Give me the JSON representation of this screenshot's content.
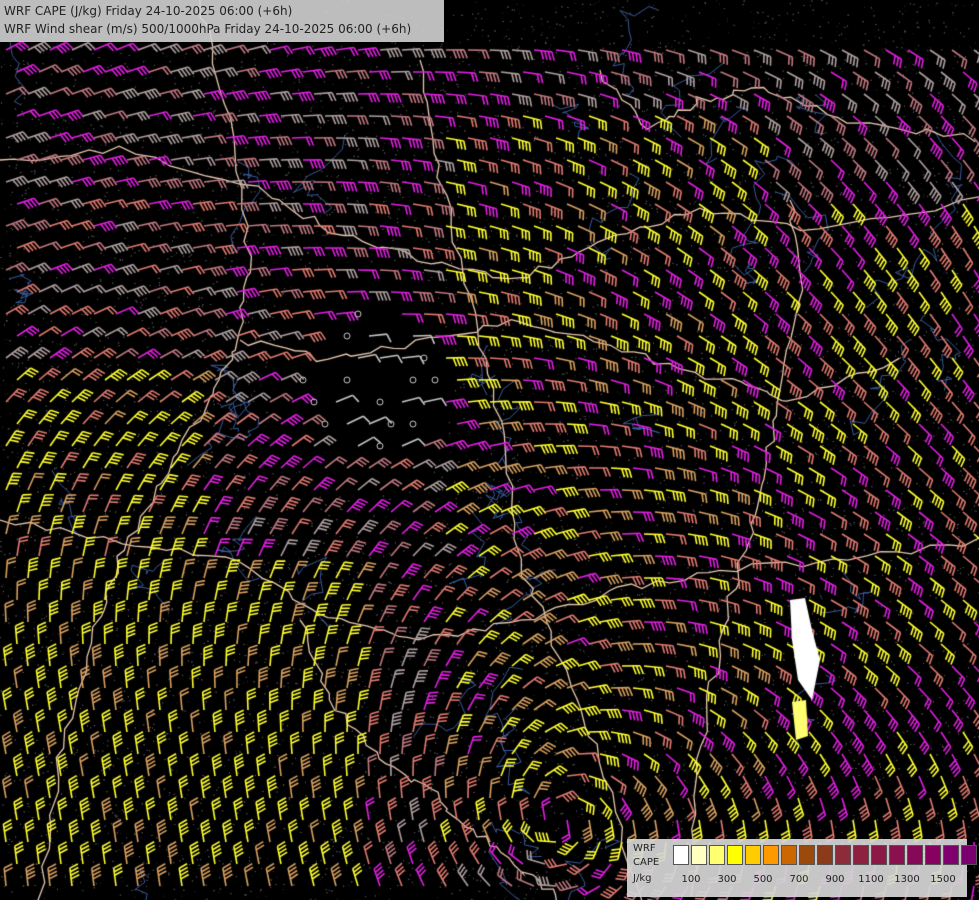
{
  "title": {
    "line1": "WRF CAPE (J/kg) Friday 24-10-2025 06:00 (+6h)",
    "line2": "WRF Wind shear (m/s) 500/1000hPa Friday 24-10-2025 06:00 (+6h)"
  },
  "legend": {
    "line1": "WRF",
    "line2": "CAPE",
    "line3": "J/kg",
    "tick_labels": [
      "100",
      "300",
      "500",
      "700",
      "900",
      "1100",
      "1300",
      "1500"
    ],
    "colors": [
      "#ffffff",
      "#ffffc0",
      "#ffff70",
      "#ffff00",
      "#ffcc00",
      "#ff9900",
      "#cc6600",
      "#9c4a0c",
      "#8b3a1a",
      "#8e2b3a",
      "#8e2040",
      "#8c1848",
      "#8a1050",
      "#880858",
      "#880060",
      "#800070",
      "#7a0070"
    ]
  },
  "colors": {
    "background": "#000000",
    "borders": "#e8c8b0",
    "rivers": "#3a5a9a",
    "barb_yellow": "#ffff30",
    "barb_tan": "#d8a060",
    "barb_salmon": "#e07a70",
    "barb_magenta": "#e020e0",
    "barb_pink": "#c07880",
    "barb_grey": "#b0a0a0"
  }
}
